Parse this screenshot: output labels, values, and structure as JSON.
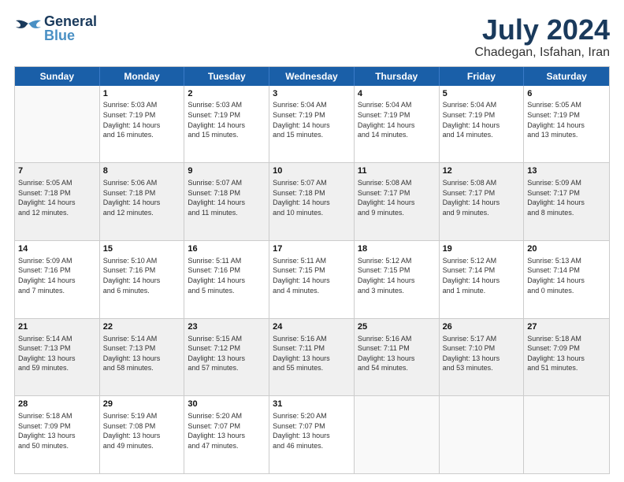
{
  "header": {
    "logo_general": "General",
    "logo_blue": "Blue",
    "title": "July 2024",
    "location": "Chadegan, Isfahan, Iran"
  },
  "days_of_week": [
    "Sunday",
    "Monday",
    "Tuesday",
    "Wednesday",
    "Thursday",
    "Friday",
    "Saturday"
  ],
  "rows": [
    {
      "alt": false,
      "cells": [
        {
          "day": "",
          "info": ""
        },
        {
          "day": "1",
          "info": "Sunrise: 5:03 AM\nSunset: 7:19 PM\nDaylight: 14 hours\nand 16 minutes."
        },
        {
          "day": "2",
          "info": "Sunrise: 5:03 AM\nSunset: 7:19 PM\nDaylight: 14 hours\nand 15 minutes."
        },
        {
          "day": "3",
          "info": "Sunrise: 5:04 AM\nSunset: 7:19 PM\nDaylight: 14 hours\nand 15 minutes."
        },
        {
          "day": "4",
          "info": "Sunrise: 5:04 AM\nSunset: 7:19 PM\nDaylight: 14 hours\nand 14 minutes."
        },
        {
          "day": "5",
          "info": "Sunrise: 5:04 AM\nSunset: 7:19 PM\nDaylight: 14 hours\nand 14 minutes."
        },
        {
          "day": "6",
          "info": "Sunrise: 5:05 AM\nSunset: 7:19 PM\nDaylight: 14 hours\nand 13 minutes."
        }
      ]
    },
    {
      "alt": true,
      "cells": [
        {
          "day": "7",
          "info": "Sunrise: 5:05 AM\nSunset: 7:18 PM\nDaylight: 14 hours\nand 12 minutes."
        },
        {
          "day": "8",
          "info": "Sunrise: 5:06 AM\nSunset: 7:18 PM\nDaylight: 14 hours\nand 12 minutes."
        },
        {
          "day": "9",
          "info": "Sunrise: 5:07 AM\nSunset: 7:18 PM\nDaylight: 14 hours\nand 11 minutes."
        },
        {
          "day": "10",
          "info": "Sunrise: 5:07 AM\nSunset: 7:18 PM\nDaylight: 14 hours\nand 10 minutes."
        },
        {
          "day": "11",
          "info": "Sunrise: 5:08 AM\nSunset: 7:17 PM\nDaylight: 14 hours\nand 9 minutes."
        },
        {
          "day": "12",
          "info": "Sunrise: 5:08 AM\nSunset: 7:17 PM\nDaylight: 14 hours\nand 9 minutes."
        },
        {
          "day": "13",
          "info": "Sunrise: 5:09 AM\nSunset: 7:17 PM\nDaylight: 14 hours\nand 8 minutes."
        }
      ]
    },
    {
      "alt": false,
      "cells": [
        {
          "day": "14",
          "info": "Sunrise: 5:09 AM\nSunset: 7:16 PM\nDaylight: 14 hours\nand 7 minutes."
        },
        {
          "day": "15",
          "info": "Sunrise: 5:10 AM\nSunset: 7:16 PM\nDaylight: 14 hours\nand 6 minutes."
        },
        {
          "day": "16",
          "info": "Sunrise: 5:11 AM\nSunset: 7:16 PM\nDaylight: 14 hours\nand 5 minutes."
        },
        {
          "day": "17",
          "info": "Sunrise: 5:11 AM\nSunset: 7:15 PM\nDaylight: 14 hours\nand 4 minutes."
        },
        {
          "day": "18",
          "info": "Sunrise: 5:12 AM\nSunset: 7:15 PM\nDaylight: 14 hours\nand 3 minutes."
        },
        {
          "day": "19",
          "info": "Sunrise: 5:12 AM\nSunset: 7:14 PM\nDaylight: 14 hours\nand 1 minute."
        },
        {
          "day": "20",
          "info": "Sunrise: 5:13 AM\nSunset: 7:14 PM\nDaylight: 14 hours\nand 0 minutes."
        }
      ]
    },
    {
      "alt": true,
      "cells": [
        {
          "day": "21",
          "info": "Sunrise: 5:14 AM\nSunset: 7:13 PM\nDaylight: 13 hours\nand 59 minutes."
        },
        {
          "day": "22",
          "info": "Sunrise: 5:14 AM\nSunset: 7:13 PM\nDaylight: 13 hours\nand 58 minutes."
        },
        {
          "day": "23",
          "info": "Sunrise: 5:15 AM\nSunset: 7:12 PM\nDaylight: 13 hours\nand 57 minutes."
        },
        {
          "day": "24",
          "info": "Sunrise: 5:16 AM\nSunset: 7:11 PM\nDaylight: 13 hours\nand 55 minutes."
        },
        {
          "day": "25",
          "info": "Sunrise: 5:16 AM\nSunset: 7:11 PM\nDaylight: 13 hours\nand 54 minutes."
        },
        {
          "day": "26",
          "info": "Sunrise: 5:17 AM\nSunset: 7:10 PM\nDaylight: 13 hours\nand 53 minutes."
        },
        {
          "day": "27",
          "info": "Sunrise: 5:18 AM\nSunset: 7:09 PM\nDaylight: 13 hours\nand 51 minutes."
        }
      ]
    },
    {
      "alt": false,
      "cells": [
        {
          "day": "28",
          "info": "Sunrise: 5:18 AM\nSunset: 7:09 PM\nDaylight: 13 hours\nand 50 minutes."
        },
        {
          "day": "29",
          "info": "Sunrise: 5:19 AM\nSunset: 7:08 PM\nDaylight: 13 hours\nand 49 minutes."
        },
        {
          "day": "30",
          "info": "Sunrise: 5:20 AM\nSunset: 7:07 PM\nDaylight: 13 hours\nand 47 minutes."
        },
        {
          "day": "31",
          "info": "Sunrise: 5:20 AM\nSunset: 7:07 PM\nDaylight: 13 hours\nand 46 minutes."
        },
        {
          "day": "",
          "info": ""
        },
        {
          "day": "",
          "info": ""
        },
        {
          "day": "",
          "info": ""
        }
      ]
    }
  ]
}
